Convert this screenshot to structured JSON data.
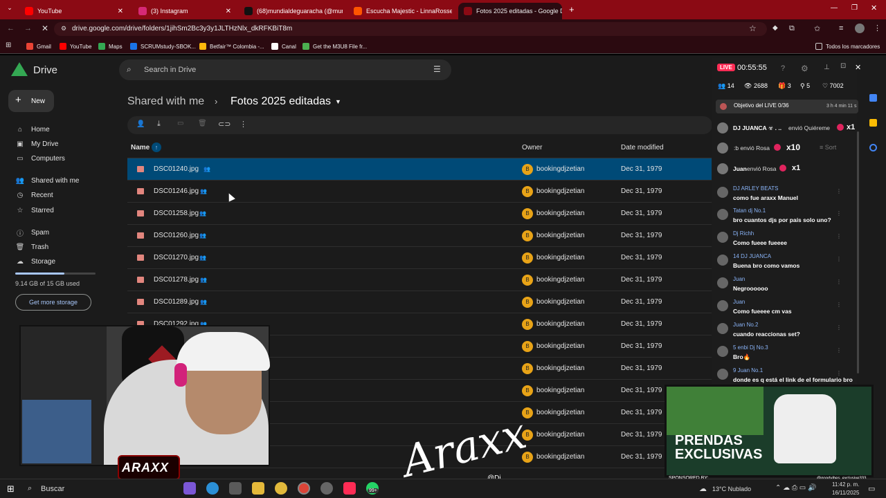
{
  "browser": {
    "tabs": [
      {
        "title": "YouTube",
        "color": "#ff0000"
      },
      {
        "title": "(3) Instagram",
        "color": "#d62976"
      },
      {
        "title": "(68)mundialdeguaracha (@mun",
        "color": "#111111"
      },
      {
        "title": "Escucha Majestic - LinnaRosse",
        "color": "#ff5500"
      },
      {
        "title": "Fotos 2025 editadas - Google D",
        "color": "#8b0a14"
      }
    ],
    "url": "drive.google.com/drive/folders/1jihSm2Bc3y3y1JLTHzNlx_dkRFKBiT8m",
    "bookmarks": [
      {
        "label": "Gmail",
        "color": "#ea4335"
      },
      {
        "label": "YouTube",
        "color": "#ff0000"
      },
      {
        "label": "Maps",
        "color": "#34a853"
      },
      {
        "label": "SCRUMstudy-SBOK...",
        "color": "#1a73e8"
      },
      {
        "label": "Betfair™ Colombia -...",
        "color": "#ffb80c"
      },
      {
        "label": "Canal",
        "color": "#ffffff"
      },
      {
        "label": "Get the M3U8 File fr...",
        "color": "#4caf50"
      }
    ],
    "all_bookmarks": "Todos los marcadores"
  },
  "drive": {
    "logo": "Drive",
    "search_placeholder": "Search in Drive",
    "new_label": "New",
    "nav": [
      {
        "label": "Home",
        "icon": "⌂"
      },
      {
        "label": "My Drive",
        "icon": "▣"
      },
      {
        "label": "Computers",
        "icon": "▭"
      },
      {
        "label": "Shared with me",
        "icon": "👥"
      },
      {
        "label": "Recent",
        "icon": "◷"
      },
      {
        "label": "Starred",
        "icon": "☆"
      },
      {
        "label": "Spam",
        "icon": "ⓘ"
      },
      {
        "label": "Trash",
        "icon": "🗑"
      },
      {
        "label": "Storage",
        "icon": "☁"
      }
    ],
    "storage_text": "9.14 GB of 15 GB used",
    "storage_fraction": 0.61,
    "get_storage": "Get more storage",
    "breadcrumb_parent": "Shared with me",
    "breadcrumb_current": "Fotos 2025 editadas",
    "columns": {
      "name": "Name",
      "owner": "Owner",
      "date": "Date modified"
    },
    "files": [
      {
        "name": "DSC01240.jpg",
        "owner": "bookingdjzetian",
        "date": "Dec 31, 1979"
      },
      {
        "name": "DSC01246.jpg",
        "owner": "bookingdjzetian",
        "date": "Dec 31, 1979"
      },
      {
        "name": "DSC01258.jpg",
        "owner": "bookingdjzetian",
        "date": "Dec 31, 1979"
      },
      {
        "name": "DSC01260.jpg",
        "owner": "bookingdjzetian",
        "date": "Dec 31, 1979"
      },
      {
        "name": "DSC01270.jpg",
        "owner": "bookingdjzetian",
        "date": "Dec 31, 1979"
      },
      {
        "name": "DSC01278.jpg",
        "owner": "bookingdjzetian",
        "date": "Dec 31, 1979"
      },
      {
        "name": "DSC01289.jpg",
        "owner": "bookingdjzetian",
        "date": "Dec 31, 1979"
      },
      {
        "name": "DSC01292.jpg",
        "owner": "bookingdjzetian",
        "date": "Dec 31, 1979"
      },
      {
        "name": "",
        "owner": "bookingdjzetian",
        "date": "Dec 31, 1979"
      },
      {
        "name": "",
        "owner": "bookingdjzetian",
        "date": "Dec 31, 1979"
      },
      {
        "name": "",
        "owner": "bookingdjzetian",
        "date": "Dec 31, 1979"
      },
      {
        "name": "",
        "owner": "bookingdjzetian",
        "date": "Dec 31, 1979"
      },
      {
        "name": "",
        "owner": "bookingdjzetian",
        "date": "Dec 31, 1979"
      },
      {
        "name": "",
        "owner": "bookingdjzetian",
        "date": "Dec 31, 1979"
      }
    ],
    "owner_initial": "B"
  },
  "live": {
    "badge": "LIVE",
    "time": "00:55:55",
    "stats": [
      {
        "icon": "👥",
        "value": "14"
      },
      {
        "icon": "👁",
        "value": "2688"
      },
      {
        "icon": "🎁",
        "value": "3"
      },
      {
        "icon": "⚲",
        "value": "5"
      },
      {
        "icon": "♡",
        "value": "7002"
      }
    ],
    "goal": "Objetivo del LIVE 0/36",
    "goal_time": "3 h 4 min 11 s",
    "gifts": [
      {
        "user": "DJ JUANCA ☣ . ..",
        "text": "envió Quiéreme",
        "count": "x1"
      },
      {
        "user": "",
        "text": ":b envió Rosa",
        "count": "x10"
      },
      {
        "user": "Juan",
        "text": "envió Rosa",
        "count": "x1"
      }
    ],
    "sort": "Sort",
    "messages": [
      {
        "name": "DJ ARLEY BEATS",
        "text": "como fue araxx Manuel"
      },
      {
        "name": "Tatan dj  No.1",
        "text": "bro cuantos djs por país solo uno?"
      },
      {
        "name": "Dj Richh",
        "text": "Como fueee fueeee"
      },
      {
        "name": "14  DJ JUANCA",
        "text": "Buena bro como vamos"
      },
      {
        "name": "Juan",
        "text": "Negroooooo"
      },
      {
        "name": "Juan",
        "text": "Como fueeee cm vas"
      },
      {
        "name": "Juan  No.2",
        "text": "cuando reaccionas set?"
      },
      {
        "name": "5  enbi Dj  No.3",
        "text": "Bro🔥"
      },
      {
        "name": "9  Juan  No.1",
        "text": "donde es q está el link de el formulario bro"
      }
    ]
  },
  "overlay": {
    "promo_line1": "PRENDAS",
    "promo_line2": "EXCLUSIVAS",
    "sponsored": "SPONSORED BY:",
    "promo_handle": "@goodvibes_exclusive333",
    "signature": "Araxx",
    "logo": "ARAXX",
    "handle": "@Dj"
  },
  "taskbar": {
    "search": "Buscar",
    "weather": "13°C  Nublado",
    "time": "11:42 p. m.",
    "date": "16/11/2025",
    "badge": "99+"
  }
}
